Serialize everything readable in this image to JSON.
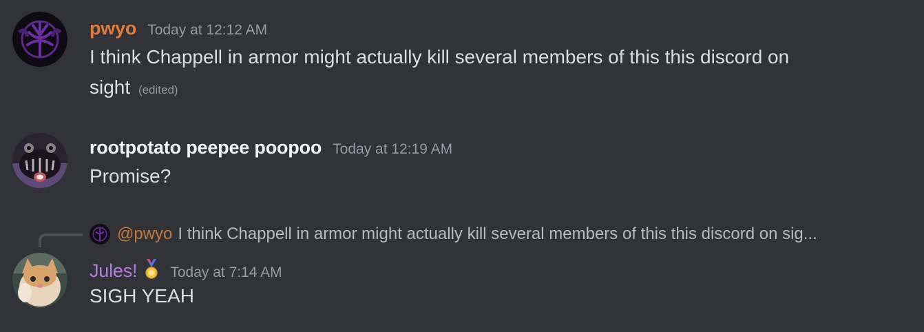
{
  "messages": [
    {
      "username": "pwyo",
      "username_color": "#e07b39",
      "timestamp": "Today at 12:12 AM",
      "text_line1": "I think Chappell in armor might actually kill several members of this this discord on",
      "text_line2": "sight",
      "edited": "(edited)",
      "avatar_icon": "purple-emblem-avatar"
    },
    {
      "username": "rootpotato peepee poopoo",
      "username_color": "#f2f3f5",
      "timestamp": "Today at 12:19 AM",
      "text": "Promise?",
      "avatar_icon": "dark-faces-avatar"
    },
    {
      "reply": {
        "mention": "@pwyo",
        "text": "I think Chappell in armor might actually kill several members of this this discord on sig..."
      },
      "username": "Jules!",
      "username_color": "#b57edc",
      "badge_icon": "medal-icon",
      "timestamp": "Today at 7:14 AM",
      "text": "SIGH YEAH",
      "avatar_icon": "cat-avatar"
    }
  ],
  "colors": {
    "background": "#313338",
    "text": "#dbdee1",
    "muted": "#949ba4"
  }
}
